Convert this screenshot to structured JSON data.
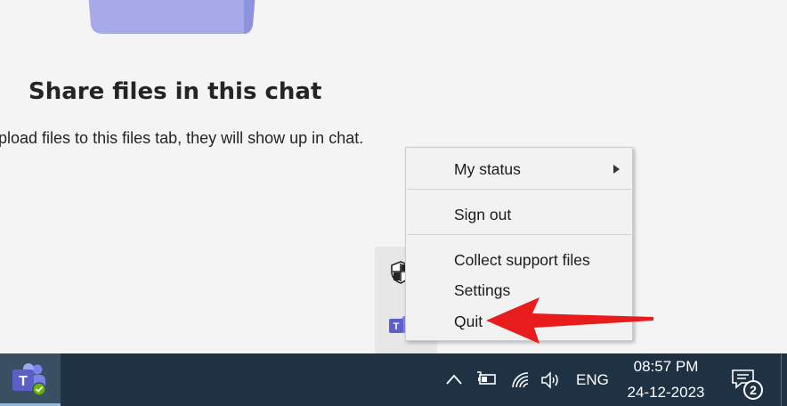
{
  "main": {
    "title": "Share files in this chat",
    "description": "pload files to this files tab, they will show up in chat."
  },
  "context_menu": {
    "items": [
      {
        "label": "My status",
        "has_submenu": true
      },
      {
        "label": "Sign out"
      },
      {
        "label": "Collect support files"
      },
      {
        "label": "Settings"
      },
      {
        "label": "Quit"
      }
    ]
  },
  "taskbar": {
    "pinned_app": {
      "name": "Microsoft Teams",
      "icon": "teams-icon",
      "status_icon": "available-check-icon"
    },
    "tray_icons": [
      "chevron-up-icon",
      "battery-icon",
      "wifi-icon",
      "volume-icon"
    ],
    "language": "ENG",
    "time": "08:57 PM",
    "date": "24-12-2023",
    "notifications_count": "2"
  },
  "colors": {
    "accent_purple": "#7b83eb",
    "teams_purple": "#5b5fc7",
    "arrow_red": "#e81c1c",
    "taskbar": "#1f3244",
    "status_green": "#6bb700"
  }
}
